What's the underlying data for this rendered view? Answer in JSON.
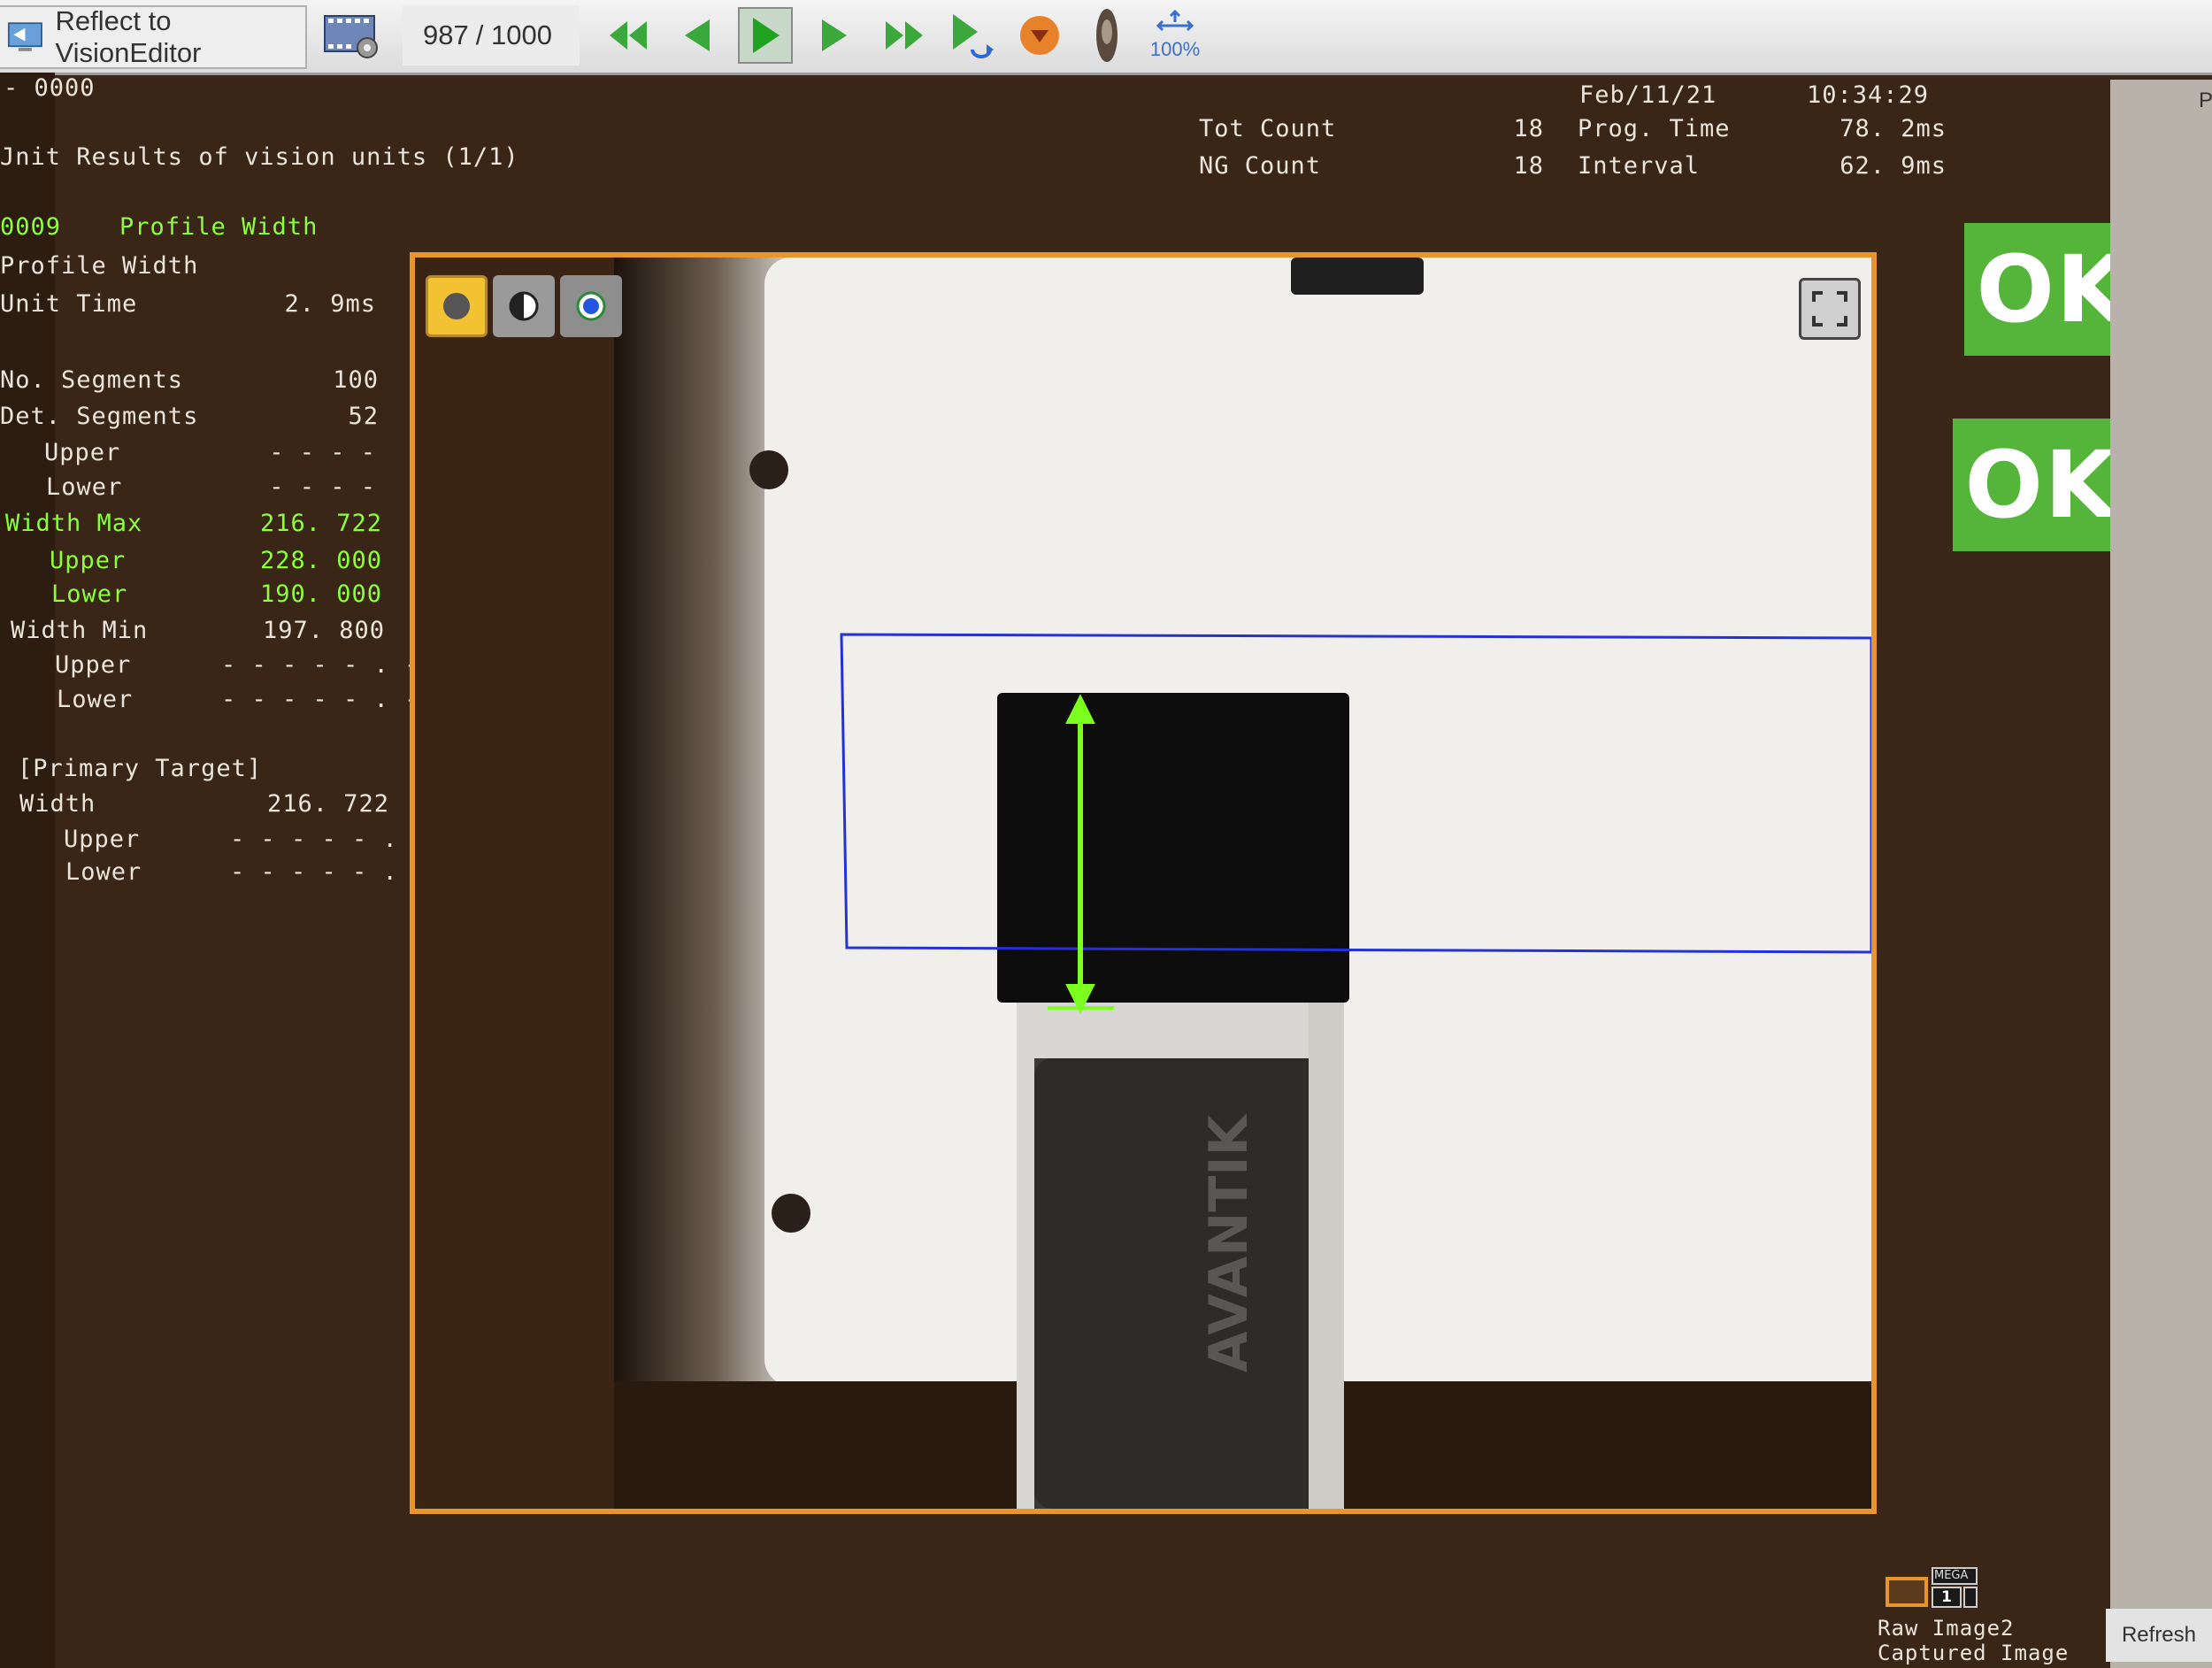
{
  "toolbar": {
    "reflect_label": "Reflect to VisionEditor",
    "frame_current": "987",
    "frame_total": "/ 1000",
    "zoom_label": "100%"
  },
  "header": {
    "code": "- 0000",
    "date": "Feb/11/21",
    "time": "10:34:29",
    "section_title": "Jnit  Results  of  vision  units  (1/1)"
  },
  "stats": {
    "tot_count_label": "Tot  Count",
    "tot_count_value": "18",
    "ng_count_label": "NG  Count",
    "ng_count_value": "18",
    "prog_time_label": "Prog.  Time",
    "prog_time_value": "78. 2ms",
    "interval_label": "Interval",
    "interval_value": "62. 9ms"
  },
  "unit": {
    "id": "0009",
    "title": "Profile  Width",
    "name": "Profile  Width",
    "unit_time_label": "Unit  Time",
    "unit_time_value": "2. 9ms",
    "no_segments_label": "No.  Segments",
    "no_segments_value": "100",
    "det_segments_label": "Det.  Segments",
    "det_segments_value": "52",
    "seg_upper_label": "Upper",
    "seg_upper_value": "- - - -",
    "seg_lower_label": "Lower",
    "seg_lower_value": "- - - -",
    "width_max_label": "Width  Max",
    "width_max_value": "216. 722",
    "max_upper_label": "Upper",
    "max_upper_value": "228. 000",
    "max_lower_label": "Lower",
    "max_lower_value": "190. 000",
    "width_min_label": "Width  Min",
    "width_min_value": "197. 800",
    "min_upper_label": "Upper",
    "min_upper_value": "- - - - - . - - -",
    "min_lower_label": "Lower",
    "min_lower_value": "- - - - - . - - -",
    "primary_target_label": "[Primary  Target]",
    "pt_width_label": "Width",
    "pt_width_value": "216. 722",
    "pt_upper_label": "Upper",
    "pt_upper_value": "- - - - - . - - -",
    "pt_lower_label": "Lower",
    "pt_lower_value": "- - - - - . - - -"
  },
  "results": {
    "ok1": "OK",
    "ok2": "OK"
  },
  "image": {
    "brand_text": "AVANTIK",
    "line1": "Raw  Image2",
    "line2": "Captured  Image",
    "badge": "MEGA",
    "badge_num": "1"
  },
  "right_panel": {
    "refresh_label": "Refresh",
    "top_letter": "P"
  },
  "colors": {
    "frame_orange": "#e8962c",
    "ok_green": "#55b53a",
    "measure_green": "#7cff1e",
    "roi_blue": "#2431d6"
  }
}
